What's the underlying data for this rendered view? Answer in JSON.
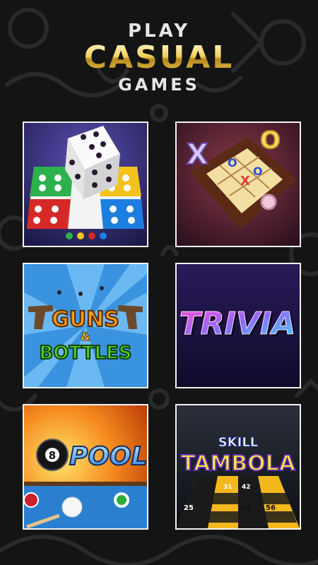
{
  "header": {
    "line1": "PLAY",
    "line2": "CASUAL",
    "line3": "GAMES"
  },
  "games": [
    {
      "icon": "ludo-icon"
    },
    {
      "icon": "tic-tac-toe-icon",
      "board": [
        "O",
        "X",
        "",
        "",
        "X",
        "O",
        "",
        "",
        ""
      ],
      "pieces": [
        "X",
        "O"
      ]
    },
    {
      "title_top": "GUNS",
      "amp": "&",
      "title_bottom": "BOTTLES"
    },
    {
      "title": "TRIVIA"
    },
    {
      "title": "POOL",
      "ball_number": "8"
    },
    {
      "title_small": "SKILL",
      "title": "TAMBOLA",
      "numbers": [
        "31",
        "42",
        "25",
        "46",
        "56"
      ]
    }
  ],
  "colors": {
    "background": "#141414",
    "gold": "#e8c24c",
    "tile_border": "#f2f2f2"
  }
}
